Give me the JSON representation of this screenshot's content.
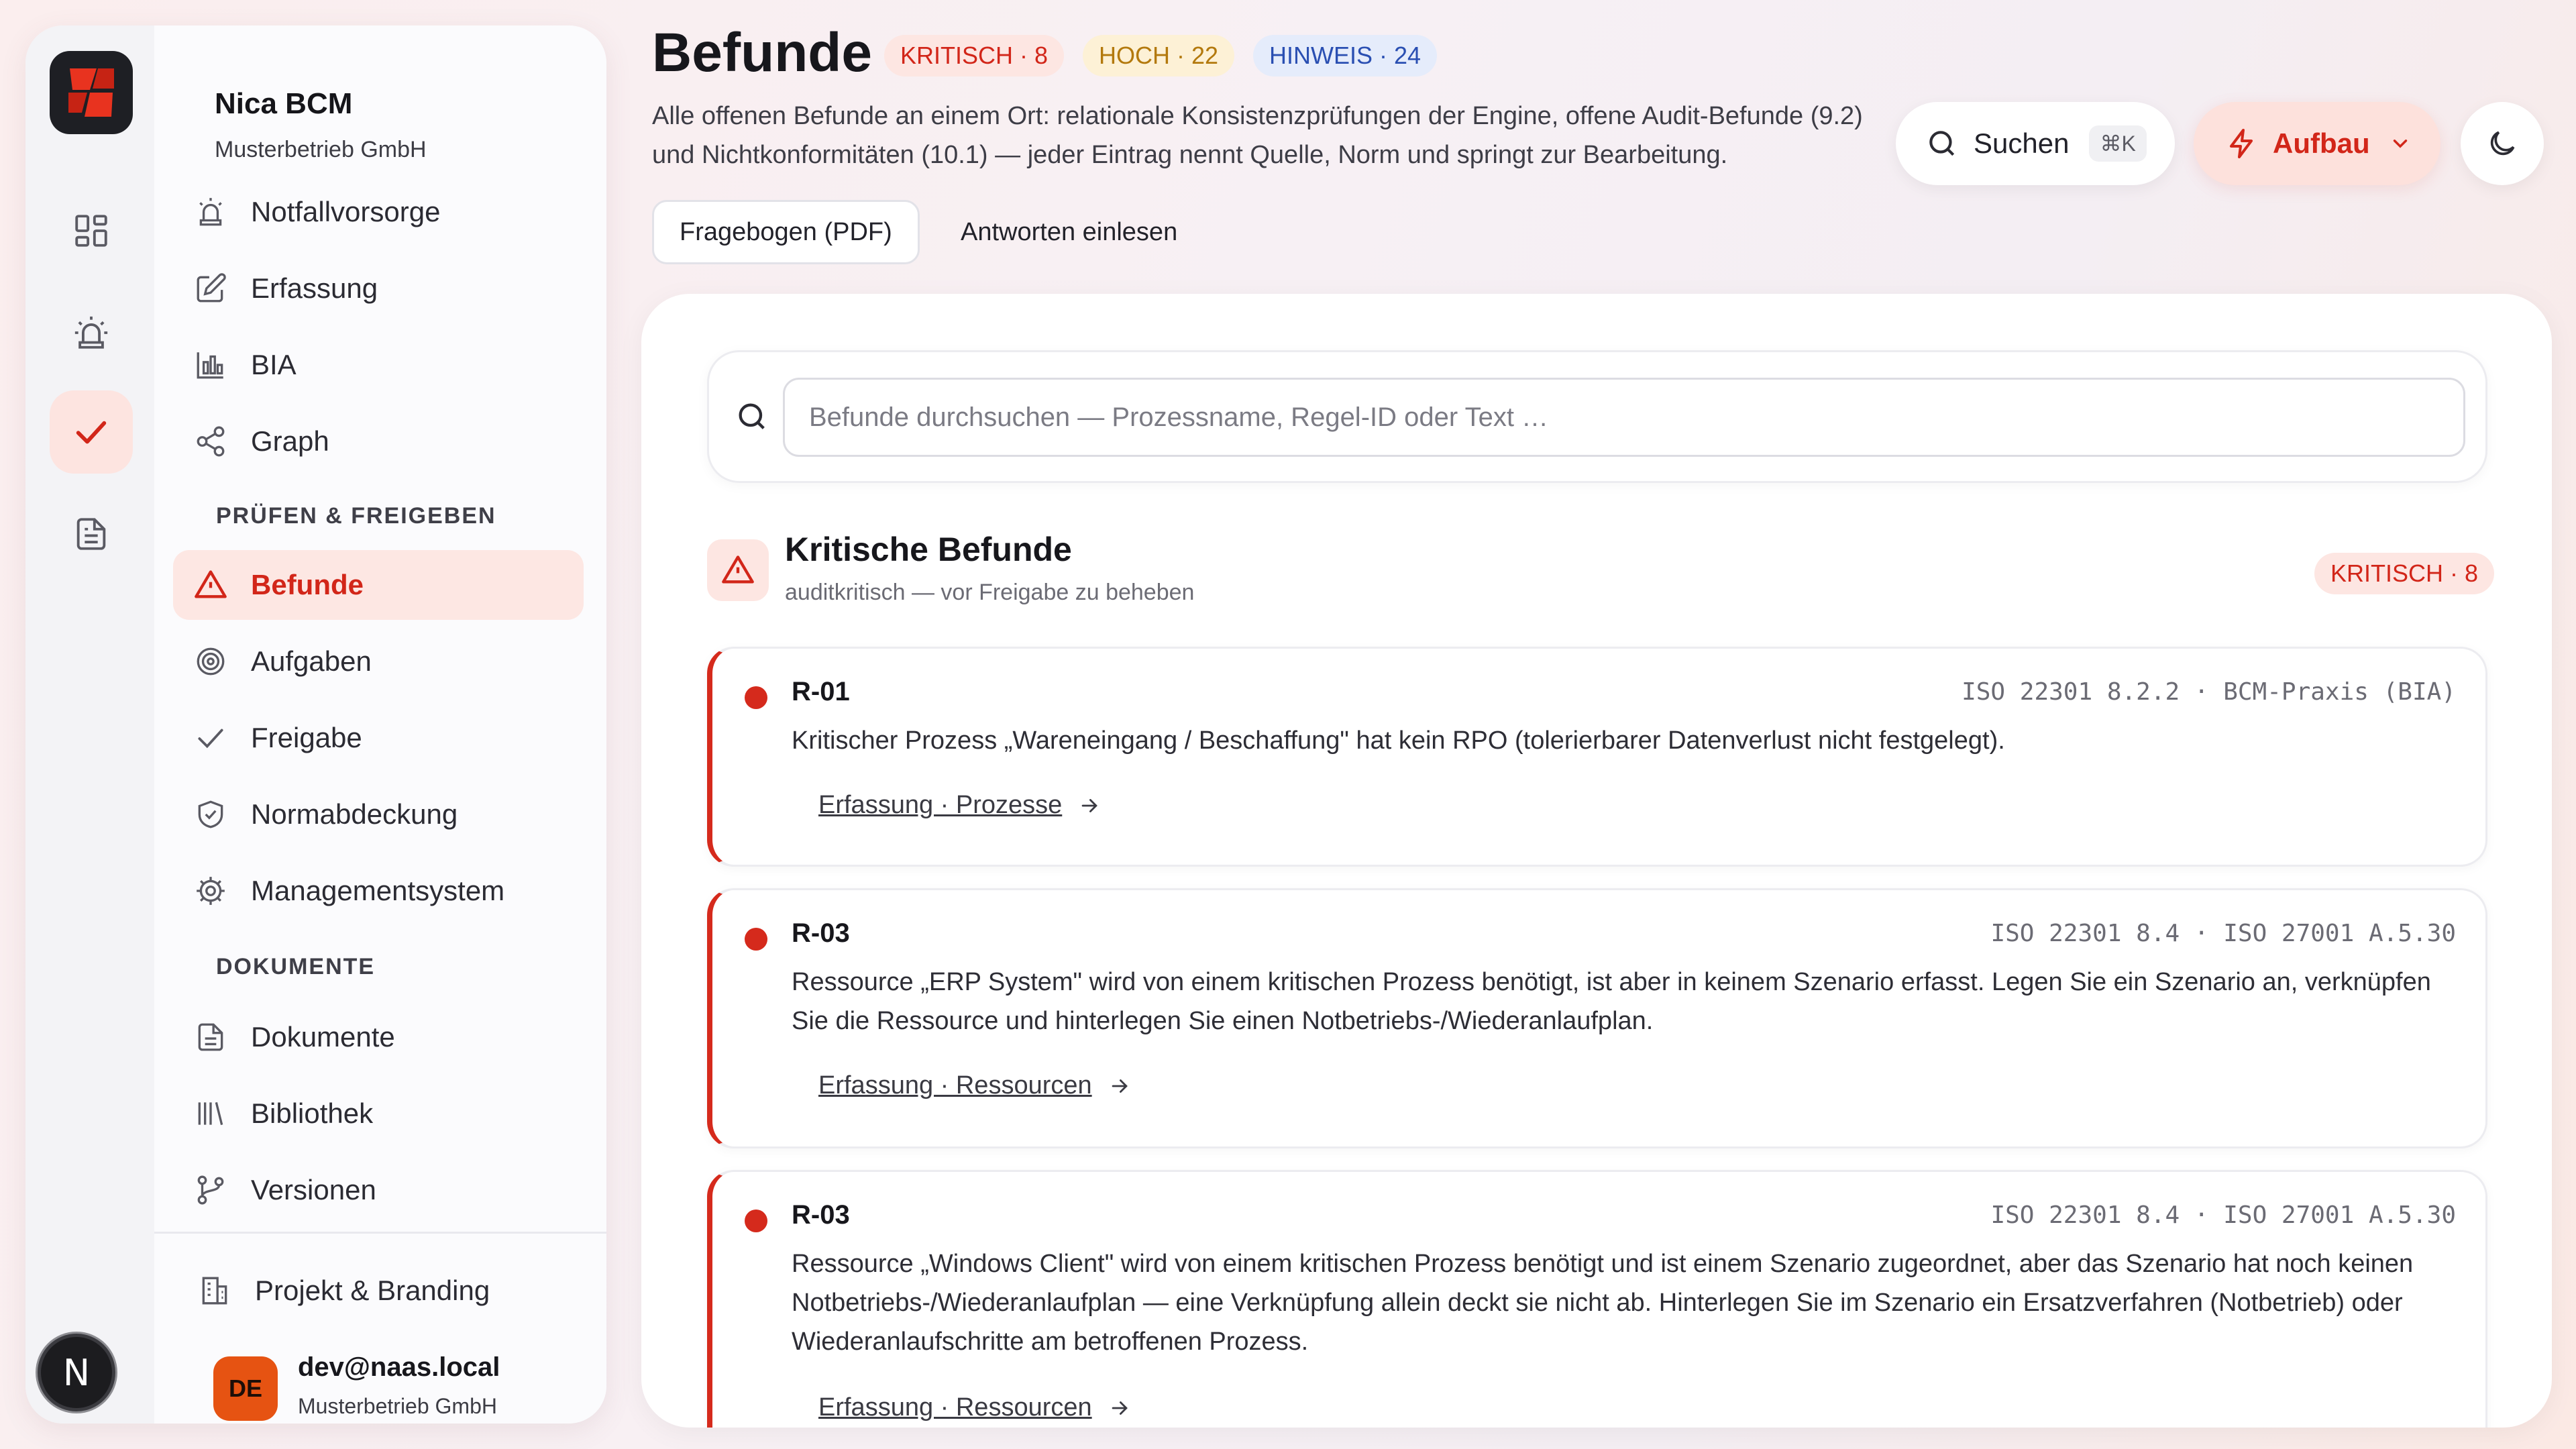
{
  "app": {
    "name": "Nica BCM",
    "org": "Musterbetrieb GmbH",
    "logo_avatar": "N"
  },
  "rail": {
    "icons": [
      "dashboard-icon",
      "siren-icon",
      "check-icon",
      "document-icon"
    ],
    "active": "check-icon"
  },
  "nav": {
    "items_top": [
      {
        "label": "Notfallvorsorge",
        "icon": "siren-icon"
      },
      {
        "label": "Erfassung",
        "icon": "edit-icon"
      },
      {
        "label": "BIA",
        "icon": "bar-chart-icon"
      },
      {
        "label": "Graph",
        "icon": "share-icon"
      }
    ],
    "section_review": "PRÜFEN & FREIGEBEN",
    "items_review": [
      {
        "label": "Befunde",
        "icon": "warning-icon",
        "active": true
      },
      {
        "label": "Aufgaben",
        "icon": "target-icon"
      },
      {
        "label": "Freigabe",
        "icon": "check-icon"
      },
      {
        "label": "Normabdeckung",
        "icon": "shield-check-icon"
      },
      {
        "label": "Managementsystem",
        "icon": "gear-icon"
      }
    ],
    "section_docs": "DOKUMENTE",
    "items_docs": [
      {
        "label": "Dokumente",
        "icon": "file-icon"
      },
      {
        "label": "Bibliothek",
        "icon": "library-icon"
      },
      {
        "label": "Versionen",
        "icon": "git-branch-icon"
      }
    ],
    "project_label": "Projekt & Branding",
    "project_icon": "building-icon"
  },
  "user": {
    "initials": "DE",
    "email": "dev@naas.local",
    "org": "Musterbetrieb GmbH",
    "badge_color": "#e65312"
  },
  "header": {
    "title": "Befunde",
    "pills": [
      {
        "label": "KRITISCH · 8",
        "kind": "crit"
      },
      {
        "label": "HOCH · 22",
        "kind": "high"
      },
      {
        "label": "HINWEIS · 24",
        "kind": "info"
      }
    ],
    "lead": "Alle offenen Befunde an einem Ort: relationale Konsistenzprüfungen der Engine, offene Audit-Befunde (9.2) und Nichtkonformitäten (10.1) — jeder Eintrag nennt Quelle, Norm und springt zur Bearbeitung.",
    "search_label": "Suchen",
    "search_shortcut": "⌘K",
    "aufbau_label": "Aufbau",
    "tabs": [
      {
        "label": "Fragebogen (PDF)",
        "active": true
      },
      {
        "label": "Antworten einlesen",
        "active": false
      }
    ]
  },
  "filter": {
    "placeholder": "Befunde durchsuchen — Prozessname, Regel-ID oder Text …"
  },
  "section": {
    "title": "Kritische Befunde",
    "subtitle": "auditkritisch — vor Freigabe zu beheben",
    "pill": "KRITISCH · 8"
  },
  "findings": [
    {
      "id": "R-01",
      "norm": "ISO 22301 8.2.2 · BCM-Praxis (BIA)",
      "text": "Kritischer Prozess „Wareneingang / Beschaffung\" hat kein RPO (tolerierbarer Datenverlust nicht festgelegt).",
      "link": "Erfassung · Prozesse"
    },
    {
      "id": "R-03",
      "norm": "ISO 22301 8.4 · ISO 27001 A.5.30",
      "text": "Ressource „ERP System\" wird von einem kritischen Prozess benötigt, ist aber in keinem Szenario erfasst. Legen Sie ein Szenario an, verknüpfen Sie die Ressource und hinterlegen Sie einen Notbetriebs-/Wiederanlaufplan.",
      "link": "Erfassung · Ressourcen"
    },
    {
      "id": "R-03",
      "norm": "ISO 22301 8.4 · ISO 27001 A.5.30",
      "text": "Ressource „Windows Client\" wird von einem kritischen Prozess benötigt und ist einem Szenario zugeordnet, aber das Szenario hat noch keinen Notbetriebs-/Wiederanlaufplan — eine Verknüpfung allein deckt sie nicht ab. Hinterlegen Sie im Szenario ein Ersatzverfahren (Notbetrieb) oder Wiederanlaufschritte am betroffenen Prozess.",
      "link": "Erfassung · Ressourcen"
    }
  ],
  "colors": {
    "accent": "#d22619",
    "accent_soft": "#fde6e2",
    "high": "#b3790d",
    "info": "#2a4fb2"
  }
}
